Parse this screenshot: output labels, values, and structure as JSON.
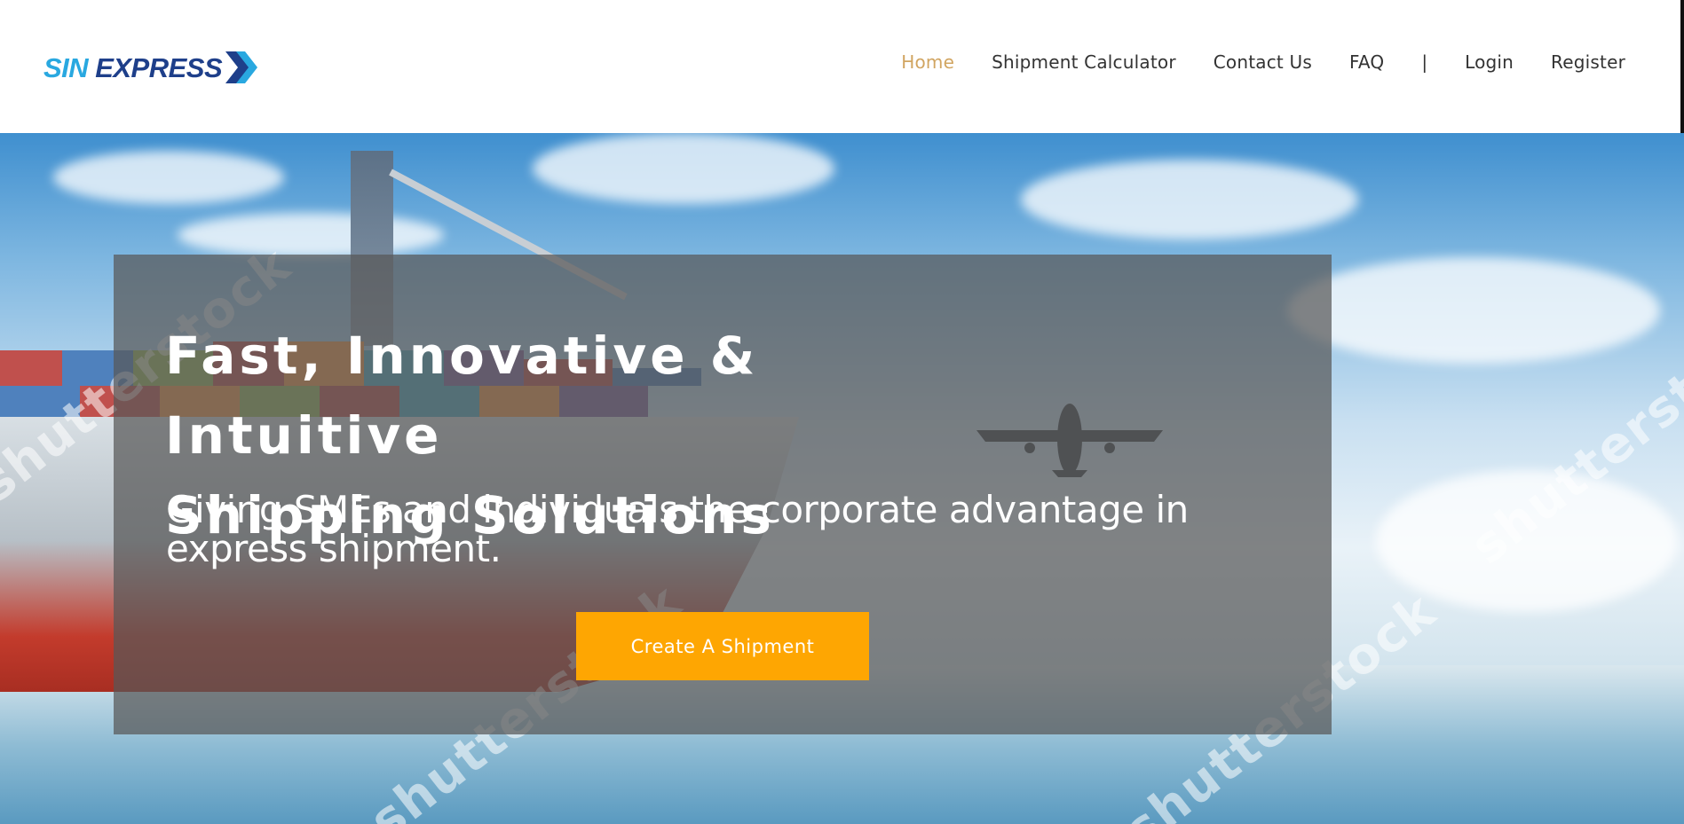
{
  "brand": {
    "sin": "SIN",
    "express": "EXPRESS",
    "logo_colors": {
      "sin": "#29a8e0",
      "express": "#1e3f8a"
    }
  },
  "nav": {
    "items": [
      {
        "label": "Home",
        "active": true
      },
      {
        "label": "Shipment Calculator",
        "active": false
      },
      {
        "label": "Contact Us",
        "active": false
      },
      {
        "label": "FAQ",
        "active": false
      }
    ],
    "separator": "|",
    "login": "Login",
    "register": "Register",
    "active_color": "#d1a561"
  },
  "hero": {
    "title_line1": "Fast, Innovative & Intuitive",
    "title_line2": "Shipping Solutions",
    "subtitle": "Giving SMEs and individuals the corporate advantage in express shipment.",
    "cta_label": "Create A Shipment",
    "cta_color": "#fea602",
    "watermark": "shutterstock"
  }
}
